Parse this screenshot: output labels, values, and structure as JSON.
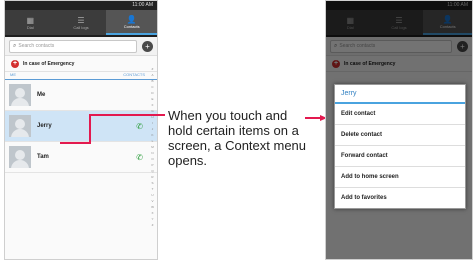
{
  "status": {
    "time": "11:00 AM"
  },
  "tabs": [
    {
      "label": "Dial",
      "icon": "dialpad-icon"
    },
    {
      "label": "Call logs",
      "icon": "call-log-icon"
    },
    {
      "label": "Contacts",
      "icon": "contacts-icon"
    }
  ],
  "search": {
    "placeholder": "Search contacts"
  },
  "ice": {
    "label": "In case of Emergency"
  },
  "section": {
    "left": "ME",
    "right": "CONTACTS"
  },
  "contacts": [
    {
      "name": "Me"
    },
    {
      "name": "Jerry"
    },
    {
      "name": "Tam"
    }
  ],
  "alphabet": "#ABCDEFGHIJKLMNOPQRSTUVWXYZ",
  "callout": "When you touch and hold certain items on a screen, a Context menu opens.",
  "menu": {
    "title": "Jerry",
    "items": [
      "Edit contact",
      "Delete contact",
      "Forward contact",
      "Add to home screen",
      "Add to favorites"
    ]
  },
  "colors": {
    "accent": "#4aa3df",
    "leader": "#e3194f",
    "call": "#2e9e3e"
  }
}
